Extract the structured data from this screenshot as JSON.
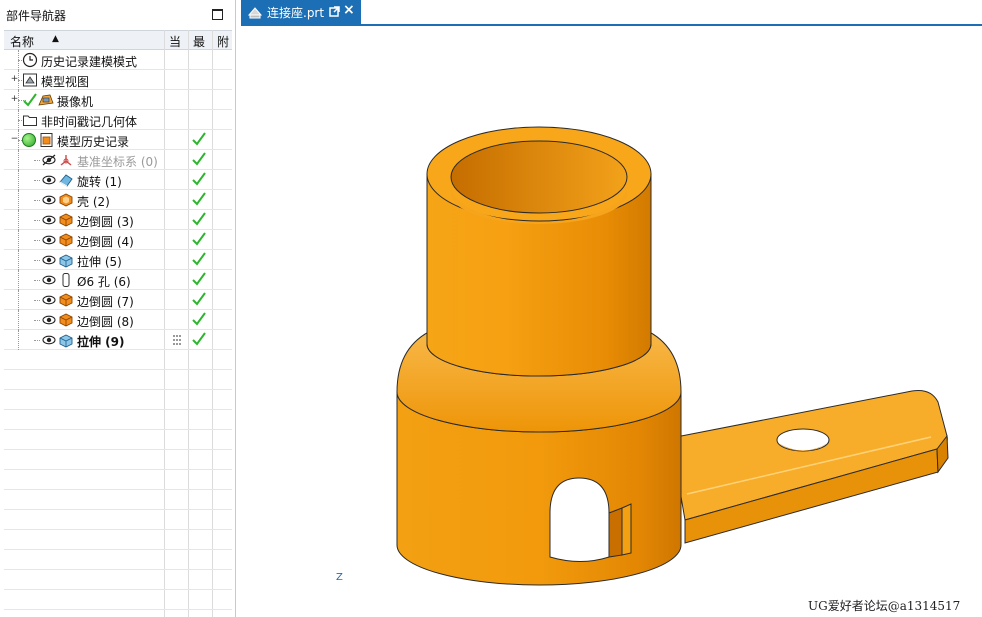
{
  "navigator": {
    "title": "部件导航器",
    "columns": {
      "name": "名称",
      "current": "当",
      "latest": "最",
      "attached": "附"
    },
    "sort_indicator": "▲",
    "nodes": [
      {
        "label": "历史记录建模模式",
        "icon": "clock-icon",
        "expander": "",
        "check": false,
        "dim": false,
        "bold": false
      },
      {
        "label": "模型视图",
        "icon": "model-view-icon",
        "expander": "+",
        "check": false,
        "dim": false,
        "bold": false
      },
      {
        "label": "摄像机",
        "icon": "camera-icon",
        "expander": "+",
        "check": false,
        "dim": false,
        "bold": false
      },
      {
        "label": "非时间戳记几何体",
        "icon": "folder-icon",
        "expander": "",
        "check": false,
        "dim": false,
        "bold": false
      },
      {
        "label": "模型历史记录",
        "icon": "history-folder-icon",
        "expander": "−",
        "check": true,
        "dim": false,
        "bold": false
      },
      {
        "label": "基准坐标系 (0)",
        "icon": "datum-csys-icon",
        "expander": "",
        "check": true,
        "dim": true,
        "bold": false
      },
      {
        "label": "旋转 (1)",
        "icon": "revolve-icon",
        "expander": "",
        "check": true,
        "dim": false,
        "bold": false
      },
      {
        "label": "壳 (2)",
        "icon": "shell-icon",
        "expander": "",
        "check": true,
        "dim": false,
        "bold": false
      },
      {
        "label": "边倒圆 (3)",
        "icon": "edge-blend-icon",
        "expander": "",
        "check": true,
        "dim": false,
        "bold": false
      },
      {
        "label": "边倒圆 (4)",
        "icon": "edge-blend-icon",
        "expander": "",
        "check": true,
        "dim": false,
        "bold": false
      },
      {
        "label": "拉伸 (5)",
        "icon": "extrude-icon",
        "expander": "",
        "check": true,
        "dim": false,
        "bold": false
      },
      {
        "label": "Ø6 孔 (6)",
        "icon": "hole-icon",
        "expander": "",
        "check": true,
        "dim": false,
        "bold": false
      },
      {
        "label": "边倒圆 (7)",
        "icon": "edge-blend-icon",
        "expander": "",
        "check": true,
        "dim": false,
        "bold": false
      },
      {
        "label": "边倒圆 (8)",
        "icon": "edge-blend-icon",
        "expander": "",
        "check": true,
        "dim": false,
        "bold": false
      },
      {
        "label": "拉伸 (9)",
        "icon": "extrude-icon",
        "expander": "",
        "check": true,
        "dim": false,
        "bold": true
      }
    ]
  },
  "graphics": {
    "tab_label": "连接座.prt",
    "triad_axis": "Z",
    "watermark": "UG爱好者论坛@a1314517"
  },
  "colors": {
    "accent": "#1c6fb5",
    "model_orange": "#f39a0c",
    "check_green": "#2db52d"
  }
}
